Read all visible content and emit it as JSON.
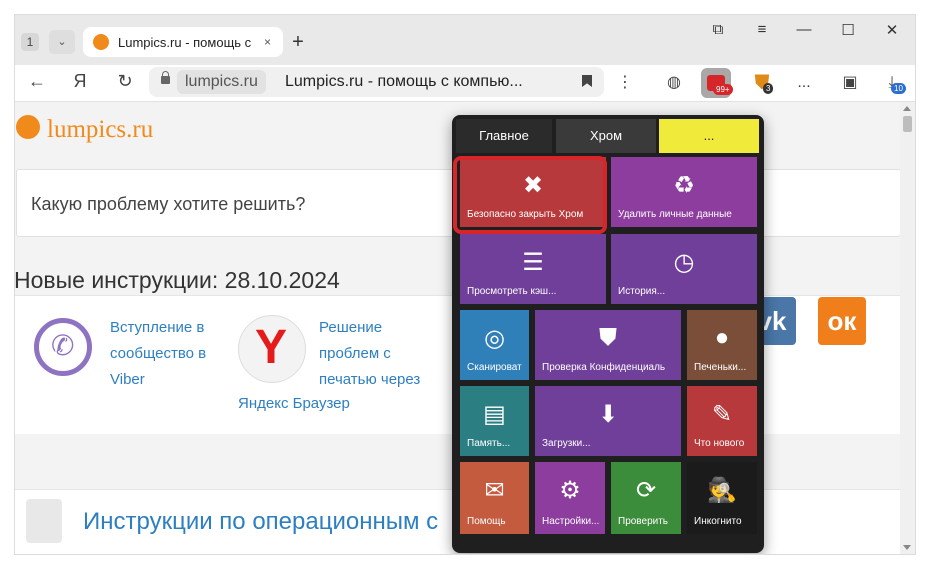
{
  "titlebar": {
    "tab_count": "1",
    "tab_title": "Lumpics.ru - помощь с",
    "tab_close": "×",
    "new_tab": "+",
    "minimize": "—",
    "maximize": "☐",
    "close": "✕",
    "pin": "⧉",
    "menu": "≡"
  },
  "addressbar": {
    "back": "←",
    "yandex": "Я",
    "reload": "↻",
    "domain": "lumpics.ru",
    "page_title": "Lumpics.ru - помощь с компью...",
    "more": "⋮",
    "ext_badge": "99+",
    "shield_badge": "3",
    "dots": "...",
    "download_badge": "10"
  },
  "page": {
    "logo_text": "lumpics.ru",
    "search_placeholder": "Какую проблему хотите решить?",
    "section_title": "Новые инструкции: 28.10.2024",
    "card1_lines": [
      "Вступление в",
      "сообщество в",
      "Viber"
    ],
    "card2_lines": [
      "Решение",
      "проблем с",
      "печатью через"
    ],
    "card2_tail": "Яндекс Браузер",
    "vk": "vk",
    "ok": "ок",
    "category_link": "Инструкции по операционным с"
  },
  "popup": {
    "tabs": [
      "Главное",
      "Хром",
      "..."
    ],
    "tiles": [
      {
        "label": "Безопасно закрыть Хром",
        "icon": "✖",
        "color": "#b8393b"
      },
      {
        "label": "Удалить личные данные",
        "icon": "♻",
        "color": "#8d3d9d"
      },
      {
        "label": "Просмотреть кэш...",
        "icon": "☰",
        "color": "#6f3f9a"
      },
      {
        "label": "История...",
        "icon": "◷",
        "color": "#6f3f9a"
      },
      {
        "label": "Сканироват",
        "icon": "◎",
        "color": "#2f7fb8"
      },
      {
        "label": "Проверка Конфиденциаль",
        "icon": "⛊",
        "color": "#6f3f9a"
      },
      {
        "label": "Печеньки...",
        "icon": "●",
        "color": "#7b4e3a"
      },
      {
        "label": "Память...",
        "icon": "▤",
        "color": "#2b7f82"
      },
      {
        "label": "Загрузки...",
        "icon": "⬇",
        "color": "#6f3f9a"
      },
      {
        "label": "Что нового",
        "icon": "✎",
        "color": "#b8393b"
      },
      {
        "label": "Помощь",
        "icon": "✉",
        "color": "#c45a3e"
      },
      {
        "label": "Настройки...",
        "icon": "⚙",
        "color": "#8d3d9d"
      },
      {
        "label": "Проверить",
        "icon": "⟳",
        "color": "#3b8d3b"
      },
      {
        "label": "Инкогнито",
        "icon": "🕵",
        "color": "#1b1b1b"
      }
    ]
  }
}
